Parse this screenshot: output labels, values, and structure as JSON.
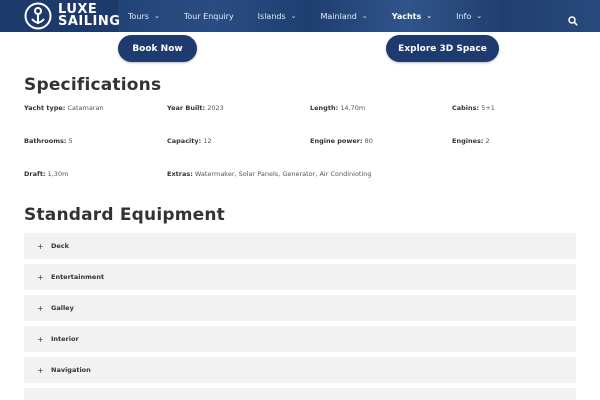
{
  "header": {
    "logo_line1": "LUXE",
    "logo_line2": "SAILING",
    "nav": [
      {
        "label": "Tours",
        "dropdown": true,
        "active": false
      },
      {
        "label": "Tour Enquiry",
        "dropdown": false,
        "active": false
      },
      {
        "label": "Islands",
        "dropdown": true,
        "active": false
      },
      {
        "label": "Mainland",
        "dropdown": true,
        "active": false
      },
      {
        "label": "Yachts",
        "dropdown": true,
        "active": true
      },
      {
        "label": "Info",
        "dropdown": true,
        "active": false
      }
    ]
  },
  "buttons": {
    "book_now": "Book Now",
    "explore_3d": "Explore 3D Space"
  },
  "specifications": {
    "title": "Specifications",
    "items": [
      {
        "label": "Yacht type:",
        "value": "Catamaran"
      },
      {
        "label": "Year Built:",
        "value": "2023"
      },
      {
        "label": "Length:",
        "value": "14,70m"
      },
      {
        "label": "Cabins:",
        "value": "5+1"
      },
      {
        "label": "Bathrooms:",
        "value": "5"
      },
      {
        "label": "Capacity:",
        "value": "12"
      },
      {
        "label": "Engine power:",
        "value": "80"
      },
      {
        "label": "Engines:",
        "value": "2"
      },
      {
        "label": "Draft:",
        "value": "1,30m"
      },
      {
        "label": "Extras:",
        "value": "Watermaker, Solar Panels, Generator, Air Condinioting"
      }
    ]
  },
  "equipment": {
    "title": "Standard Equipment",
    "plus_glyph": "+",
    "items": [
      {
        "label": "Deck"
      },
      {
        "label": "Entertainment"
      },
      {
        "label": "Galley"
      },
      {
        "label": "Interior"
      },
      {
        "label": "Navigation"
      }
    ]
  },
  "colors": {
    "header_bg": "#1c3a6b",
    "button_bg": "#1f3a6e",
    "accordion_bg": "#f2f2f2"
  }
}
